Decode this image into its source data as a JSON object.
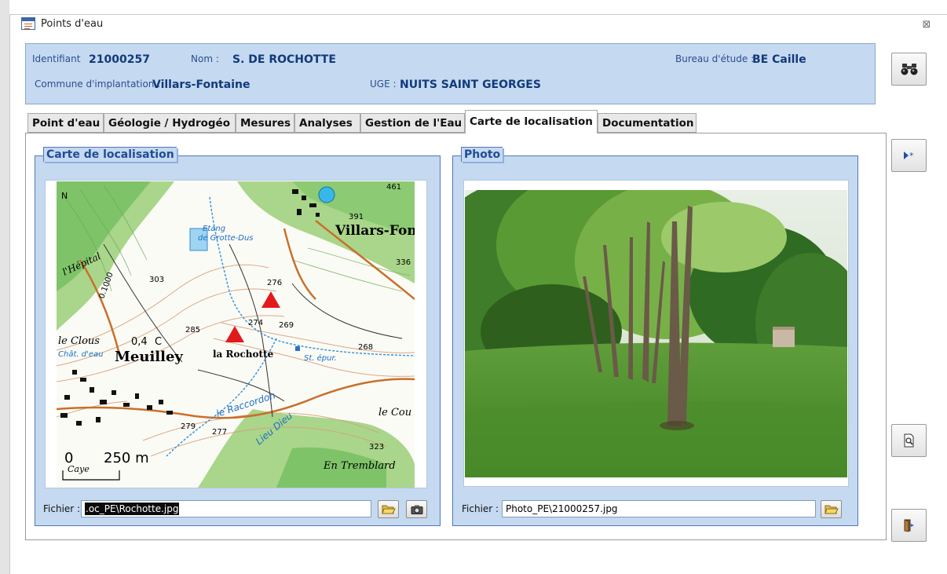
{
  "window": {
    "title": "Points d'eau",
    "close_glyph": "⊠"
  },
  "header": {
    "identifiant_label": "Identifiant",
    "identifiant_value": "21000257",
    "nom_label": "Nom :",
    "nom_value": "S. DE ROCHOTTE",
    "bureau_label": "Bureau d'étude :",
    "bureau_value": "BE Caille",
    "commune_label": "Commune d'implantation :",
    "commune_value": "Villars-Fontaine",
    "uge_label": "UGE :",
    "uge_value": "NUITS SAINT GEORGES"
  },
  "tabs": [
    {
      "label": "Point d'eau",
      "active": false
    },
    {
      "label": "Géologie / Hydrogéo",
      "active": false
    },
    {
      "label": "Mesures",
      "active": false
    },
    {
      "label": "Analyses",
      "active": false
    },
    {
      "label": "Gestion de l'Eau",
      "active": false
    },
    {
      "label": "Carte de localisation",
      "active": true
    },
    {
      "label": "Documentation",
      "active": false
    }
  ],
  "map_group": {
    "title": "Carte de localisation",
    "file_label": "Fichier :",
    "file_value": "Loc_PE\\Rochotte.jpg",
    "file_value_visible": ".oc_PE\\Rochotte.jpg",
    "map_labels": {
      "villars": "Villars-Fonta",
      "etang": "Etang",
      "grotte": "de Grotte-Dus",
      "meuilley": "Meuilley",
      "rochotte": "la Rochotte",
      "cloux": "le Clous",
      "chateau": "Chât. d'eau",
      "st_epur": "St. épur.",
      "raccordon": "le Raccordon",
      "lieu_dieu": "Lieu Dieu",
      "tremblard": "En Tremblard",
      "le_cou": "le Cou",
      "hepital": "l'Hépital",
      "caye": "Caye",
      "scale_0": "0",
      "scale_250": "250 m",
      "spot_461": "461",
      "spot_391": "391",
      "spot_336": "336",
      "spot_303": "303",
      "spot_285": "285",
      "spot_276": "276",
      "spot_274": "274",
      "spot_269": "269",
      "spot_268": "268",
      "spot_279": "279",
      "spot_277": "277",
      "spot_323": "323",
      "spot_04": "0,4",
      "spot_c": "C",
      "spot_1000": "0.1000",
      "spot_n": "N"
    }
  },
  "photo_group": {
    "title": "Photo",
    "file_label": "Fichier :",
    "file_value": "Photo_PE\\21000257.jpg"
  },
  "icons": {
    "search": "binoculars-icon",
    "new_record": "new-record-icon",
    "preview": "print-preview-icon",
    "exit": "exit-door-icon",
    "folder": "folder-open-icon",
    "camera": "camera-icon"
  },
  "colors": {
    "panel_blue": "#c5d9f1",
    "label_blue": "#2a4f8f",
    "value_blue": "#123a7a",
    "legend_blue": "#1f4d94"
  }
}
